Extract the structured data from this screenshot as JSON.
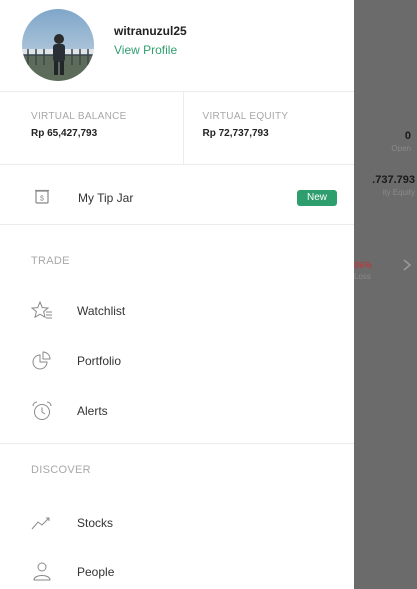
{
  "background_app": {
    "stat1_value": "0",
    "stat1_label": "Open",
    "stat2_value": ".737.793",
    "stat2_label": "ity Equity",
    "stat3_value": "06%",
    "stat3_label": "Loss"
  },
  "profile": {
    "username": "witranuzul25",
    "view_profile": "View Profile"
  },
  "balances": {
    "virtual_balance_label": "VIRTUAL BALANCE",
    "virtual_balance_value": "Rp 65,427,793",
    "virtual_equity_label": "VIRTUAL EQUITY",
    "virtual_equity_value": "Rp 72,737,793"
  },
  "tip_jar": {
    "label": "My Tip Jar",
    "badge": "New"
  },
  "trade": {
    "heading": "TRADE",
    "items": [
      {
        "label": "Watchlist",
        "icon": "watchlist-star-icon"
      },
      {
        "label": "Portfolio",
        "icon": "portfolio-pie-icon"
      },
      {
        "label": "Alerts",
        "icon": "alarm-clock-icon"
      }
    ]
  },
  "discover": {
    "heading": "DISCOVER",
    "items": [
      {
        "label": "Stocks",
        "icon": "stocks-trend-icon"
      },
      {
        "label": "People",
        "icon": "people-icon"
      }
    ]
  },
  "colors": {
    "accent_green": "#2f9e6e",
    "overlay_gray": "#6b6b6b",
    "loss_red": "#b04040"
  }
}
